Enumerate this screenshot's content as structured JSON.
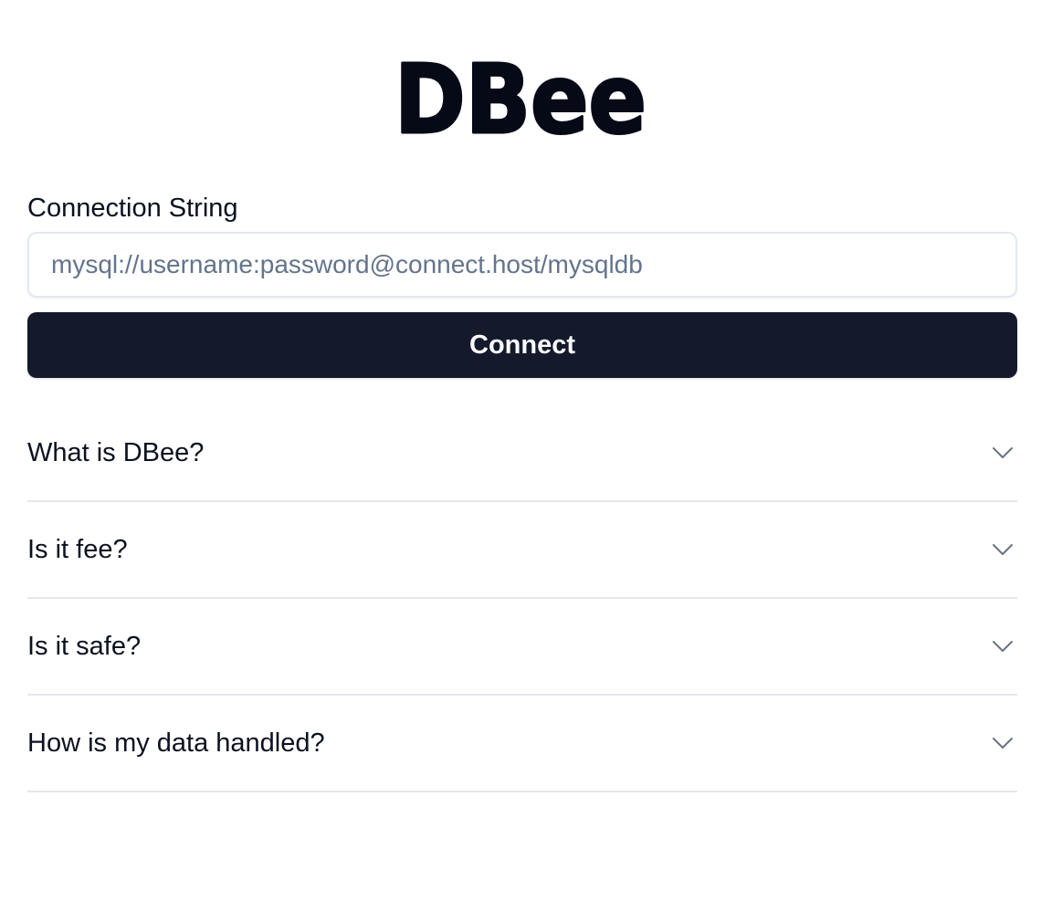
{
  "logo": {
    "text": "DBee"
  },
  "connection": {
    "label": "Connection String",
    "placeholder": "mysql://username:password@connect.host/mysqldb",
    "value": "",
    "button_label": "Connect"
  },
  "faq": {
    "items": [
      {
        "question": "What is DBee?",
        "icon": "chevron-down-icon"
      },
      {
        "question": "Is it fee?",
        "icon": "chevron-down-icon"
      },
      {
        "question": "Is it safe?",
        "icon": "chevron-down-icon"
      },
      {
        "question": "How is my data handled?",
        "icon": "chevron-down-icon"
      }
    ]
  },
  "colors": {
    "text": "#0b1120",
    "button_bg": "#141a2b",
    "button_text": "#f8fafc",
    "placeholder": "#64748b",
    "border": "#e2e8f0",
    "divider": "#e5e7eb",
    "chevron": "#6b7280"
  }
}
